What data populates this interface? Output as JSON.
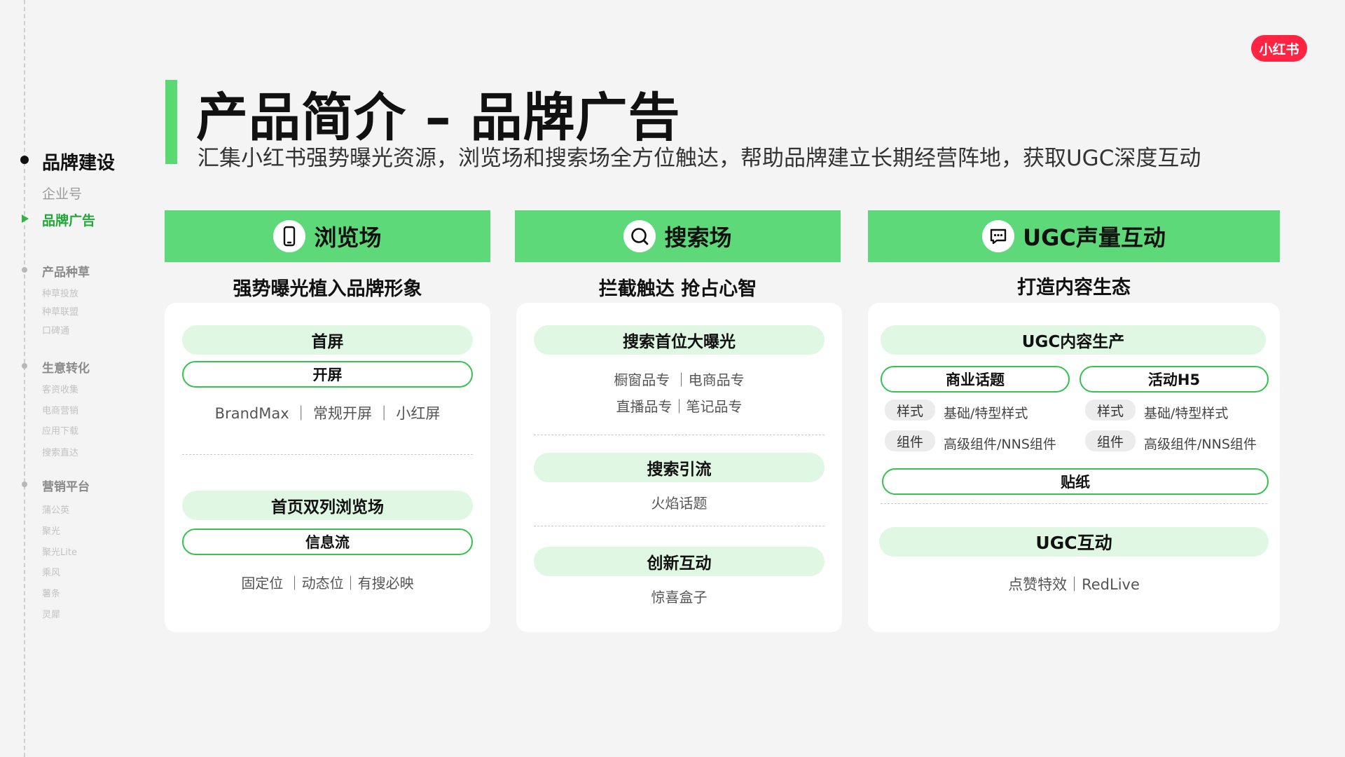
{
  "brand": {
    "logo": "小红书",
    "accent": "#5ed979",
    "logo_color": "#ff2442"
  },
  "header": {
    "title": "产品简介 – 品牌广告",
    "subtitle": "汇集小红书强势曝光资源，浏览场和搜索场全方位触达，帮助品牌建立长期经营阵地，获取UGC深度互动"
  },
  "nav": {
    "section": "品牌建设",
    "items": [
      {
        "label": "企业号"
      },
      {
        "label": "品牌广告"
      }
    ],
    "groups": [
      {
        "label": "产品种草",
        "subs": [
          "种草投放",
          "种草联盟",
          "口碑通"
        ]
      },
      {
        "label": "生意转化",
        "subs": [
          "客资收集",
          "电商营销",
          "应用下载",
          "搜索直达"
        ]
      },
      {
        "label": "营销平台",
        "subs": [
          "蒲公英",
          "聚光",
          "聚光Lite",
          "乘风",
          "薯条",
          "灵犀"
        ]
      }
    ]
  },
  "columns": {
    "browse": {
      "title": "浏览场",
      "icon": "phone-icon",
      "subtitle": "强势曝光植入品牌形象",
      "block1": {
        "fill": "首屏",
        "outline": "开屏",
        "desc": "BrandMax ｜ 常规开屏 ｜ 小红屏"
      },
      "block2": {
        "fill": "首页双列浏览场",
        "outline": "信息流",
        "desc": "固定位 ｜动态位｜有搜必映"
      }
    },
    "search": {
      "title": "搜索场",
      "icon": "search-icon",
      "subtitle": "拦截触达  抢占心智",
      "block1": {
        "fill": "搜索首位大曝光",
        "line1": "橱窗品专 ｜电商品专",
        "line2": "直播品专｜笔记品专"
      },
      "block2": {
        "fill": "搜索引流",
        "desc": "火焰话题"
      },
      "block3": {
        "fill": "创新互动",
        "desc": "惊喜盒子"
      }
    },
    "ugc": {
      "title": "UGC声量互动",
      "icon": "comment-icon",
      "subtitle": "打造内容生态",
      "block1": {
        "fill": "UGC内容生产",
        "left": {
          "pill": "商业话题",
          "tag1": "样式",
          "val1": "基础/特型样式",
          "tag2": "组件",
          "val2": "高级组件/NNS组件"
        },
        "right": {
          "pill": "活动H5",
          "tag1": "样式",
          "val1": "基础/特型样式",
          "tag2": "组件",
          "val2": "高级组件/NNS组件"
        },
        "sticker": "贴纸"
      },
      "block2": {
        "fill": "UGC互动",
        "desc": "点赞特效｜RedLive"
      }
    }
  }
}
